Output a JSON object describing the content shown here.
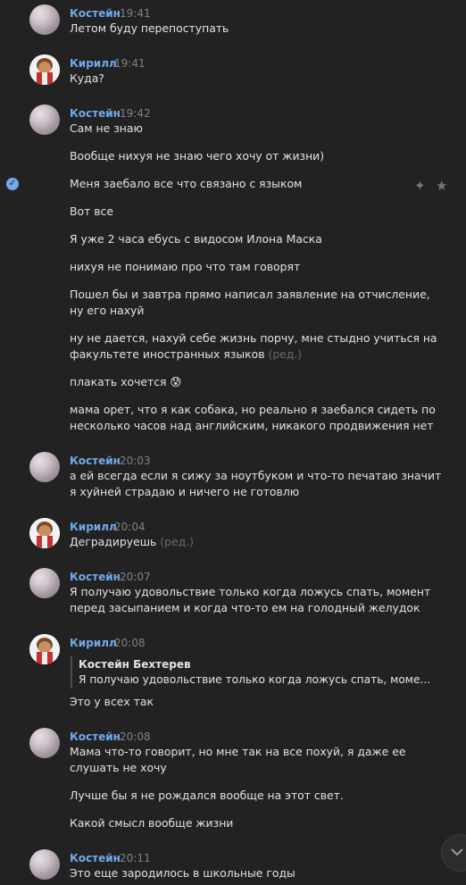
{
  "chat": {
    "blocks": [
      {
        "author": "Костейн",
        "time": "19:41",
        "avatar": "kostein-avatar",
        "messages": [
          "Летом буду перепоступать"
        ]
      },
      {
        "author": "Кирилл",
        "time": "19:41",
        "avatar": "kirill-avatar",
        "messages": [
          "Куда?"
        ]
      },
      {
        "author": "Костейн",
        "time": "19:42",
        "avatar": "kostein-avatar",
        "messages": [
          "Сам не знаю",
          "Вообще нихуя не знаю чего хочу от жизни)",
          "Меня заебало все что связано с языком",
          "Вот все",
          "Я уже 2 часа ебусь с видосом Илона Маска",
          "нихуя не понимаю про что там говорят",
          "Пошел бы и завтра прямо написал заявление на отчисление,",
          "ну его нахуй",
          "ну не дается, нахуй себе жизнь порчу, мне стыдно учиться на",
          "факультете иностранных языков",
          "плакать хочется 😰",
          "мама орет, что я как собака, но реально я заебался сидеть по",
          "несколько часов над английским, никакого продвижения нет"
        ]
      },
      {
        "author": "Костейн",
        "time": "20:03",
        "avatar": "kostein-avatar",
        "messages": [
          "а ей всегда если я сижу за ноутбуком и что-то печатаю значит",
          "я хуйней страдаю и ничего не готовлю"
        ]
      },
      {
        "author": "Кирилл",
        "time": "20:04",
        "avatar": "kirill-avatar",
        "messages": [
          "Деградируешь"
        ]
      },
      {
        "author": "Костейн",
        "time": "20:07",
        "avatar": "kostein-avatar",
        "messages": [
          "Я получаю удовольствие только когда ложусь спать, момент",
          "перед засыпанием и когда что-то ем на голодный желудок"
        ]
      },
      {
        "author": "Кирилл",
        "time": "20:08",
        "avatar": "kirill-avatar",
        "messages": [
          "Это у всех так"
        ],
        "quote": {
          "author": "Костейн Бехтерев",
          "text": "Я получаю удовольствие только когда ложусь спать, моме..."
        }
      },
      {
        "author": "Костейн",
        "time": "20:08",
        "avatar": "kostein-avatar",
        "messages": [
          "Мама что-то говорит, но мне так на все похуй, я даже ее",
          "слушать не хочу",
          "Лучше бы я не рождался вообще на этот свет.",
          "Какой смысл вообще жизни"
        ]
      },
      {
        "author": "Костейн",
        "time": "20:11",
        "avatar": "kostein-avatar",
        "messages": [
          "Это еще зародилось в школьные годы"
        ]
      }
    ],
    "edited_label": "(ред.)"
  },
  "icons": {
    "selected": "check-circle-icon",
    "actions": [
      "sparkle-icon",
      "star-icon"
    ],
    "scroll": "chevron-down-icon"
  },
  "colors": {
    "background": "#222222",
    "author_link": "#71aaeb",
    "text": "#e1e3e6",
    "time": "#828282",
    "edited": "#6b6b6b"
  }
}
